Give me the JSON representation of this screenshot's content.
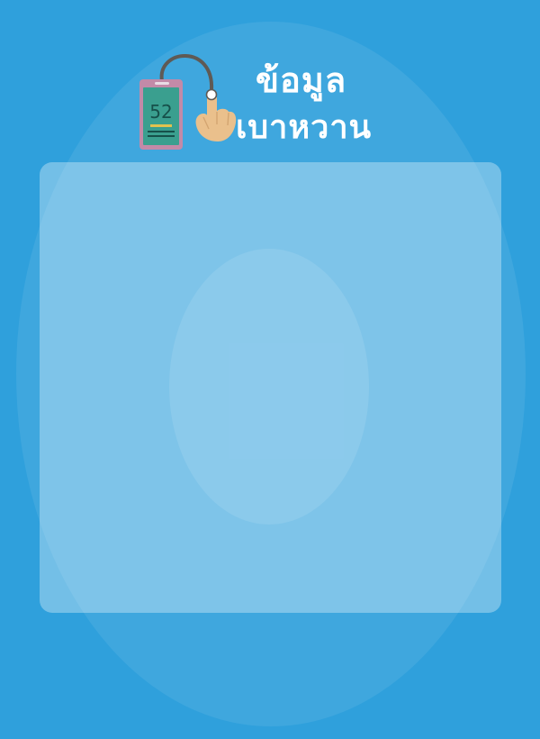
{
  "header": {
    "title_line_1": "ข้อมูล",
    "title_line_2": "เบาหวาน",
    "icon": "glucometer-with-pointing-hand-icon",
    "glucometer_reading": "52"
  },
  "colors": {
    "background": "#2fa0dc",
    "panel": "#84c3e8",
    "title_text": "#ffffff",
    "meter_screen": "#3a9f8f",
    "meter_body": "#c28aa8",
    "hand": "#eac08c",
    "cable": "#5f5a55"
  }
}
